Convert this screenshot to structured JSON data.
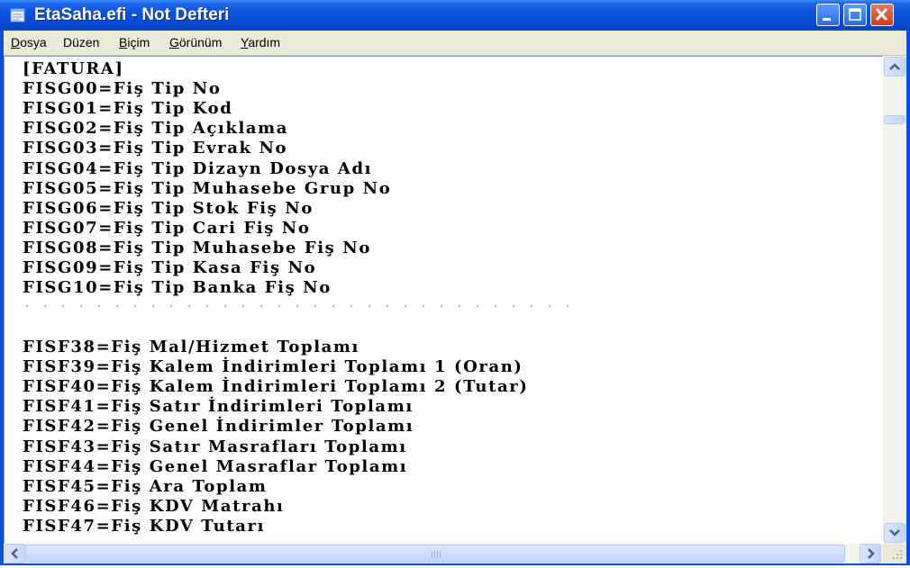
{
  "window": {
    "title": "EtaSaha.efi - Not Defteri"
  },
  "menu": {
    "items": [
      {
        "label": "Dosya",
        "mnemonic": "D",
        "rest": "osya"
      },
      {
        "label": "Düzen",
        "mnemonic": "",
        "rest": "Düzen"
      },
      {
        "label": "Biçim",
        "mnemonic": "B",
        "rest": "içim"
      },
      {
        "label": "Görünüm",
        "mnemonic": "G",
        "rest": "örünüm"
      },
      {
        "label": "Yardım",
        "mnemonic": "Y",
        "rest": "ardım"
      }
    ]
  },
  "editor": {
    "lines_top": [
      "[FATURA]",
      "FISG00=Fiş Tip No",
      "FISG01=Fiş Tip Kod",
      "FISG02=Fiş Tip Açıklama",
      "FISG03=Fiş Tip Evrak No",
      "FISG04=Fiş Tip Dizayn Dosya Adı",
      "FISG05=Fiş Tip Muhasebe Grup No",
      "FISG06=Fiş Tip Stok Fiş No",
      "FISG07=Fiş Tip Cari Fiş No",
      "FISG08=Fiş Tip Muhasebe Fiş No",
      "FISG09=Fiş Tip Kasa Fiş No",
      "FISG10=Fiş Tip Banka Fiş No"
    ],
    "lines_bottom": [
      "FISF38=Fiş Mal/Hizmet Toplamı",
      "FISF39=Fiş Kalem İndirimleri Toplamı 1 (Oran)",
      "FISF40=Fiş Kalem İndirimleri Toplamı 2 (Tutar)",
      "FISF41=Fiş Satır İndirimleri Toplamı",
      "FISF42=Fiş Genel İndirimler Toplamı",
      "FISF43=Fiş Satır Masrafları Toplamı",
      "FISF44=Fiş Genel Masraflar Toplamı",
      "FISF45=Fiş Ara Toplam",
      "FISF46=Fiş KDV Matrahı",
      "FISF47=Fiş KDV Tutarı"
    ]
  },
  "icons": {
    "app": "notepad-icon",
    "minimize": "minimize-icon",
    "maximize": "maximize-icon",
    "close": "close-icon"
  },
  "colors": {
    "titlebar": "#0a52db",
    "close_button": "#c8401c",
    "menubar": "#ece9d8"
  }
}
